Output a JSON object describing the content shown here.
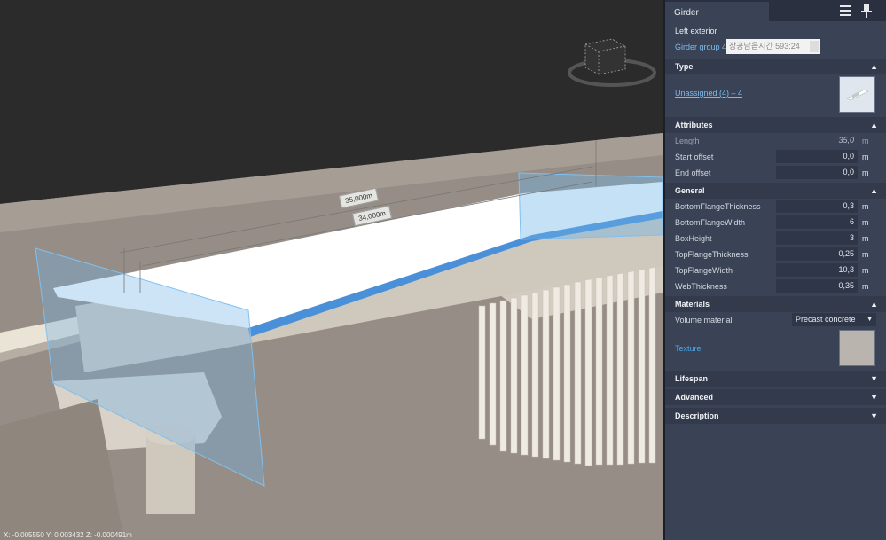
{
  "panel": {
    "tab_title": "Girder",
    "subtitle": "Left exterior",
    "group_link": "Girder group 4",
    "group_input_value": "장공남읍시간 593:24",
    "sections": {
      "type": "Type",
      "attributes": "Attributes",
      "general": "General",
      "materials": "Materials",
      "lifespan": "Lifespan",
      "advanced": "Advanced",
      "description": "Description"
    },
    "type_link": "Unassigned (4) – 4",
    "attributes": {
      "length": {
        "label": "Length",
        "value": "35,0",
        "unit": "m"
      },
      "start_offset": {
        "label": "Start offset",
        "value": "0,0",
        "unit": "m"
      },
      "end_offset": {
        "label": "End offset",
        "value": "0,0",
        "unit": "m"
      }
    },
    "general": [
      {
        "label": "BottomFlangeThickness",
        "value": "0,3",
        "unit": "m"
      },
      {
        "label": "BottomFlangeWidth",
        "value": "6",
        "unit": "m"
      },
      {
        "label": "BoxHeight",
        "value": "3",
        "unit": "m"
      },
      {
        "label": "TopFlangeThickness",
        "value": "0,25",
        "unit": "m"
      },
      {
        "label": "TopFlangeWidth",
        "value": "10,3",
        "unit": "m"
      },
      {
        "label": "WebThickness",
        "value": "0,35",
        "unit": "m"
      }
    ],
    "materials": {
      "volume_material_label": "Volume material",
      "volume_material_value": "Precast concrete",
      "texture_label": "Texture"
    }
  },
  "viewport": {
    "dimension_outer": "35,000m",
    "dimension_inner": "34,000m",
    "coords": "X: -0.005550  Y: 0.003432  Z: -0.000491m"
  },
  "colors": {
    "panel_bg": "#3a4356",
    "section_bg": "#323a4b",
    "link": "#7fb9ea",
    "sky": "#2b2b2b",
    "ground": "#968e86",
    "deck": "#ffffff",
    "selection_blue": "#6fb3e8"
  },
  "icons": [
    "view-cube-icon",
    "menu-icon",
    "pin-icon",
    "chevron-up-icon",
    "chevron-down-icon",
    "dropdown-arrow-icon"
  ]
}
